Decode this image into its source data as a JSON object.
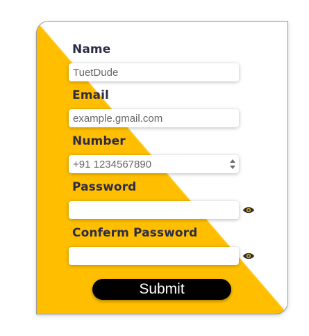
{
  "form": {
    "name": {
      "label": "Name",
      "value": "TuetDude"
    },
    "email": {
      "label": "Email",
      "value": "example.gmail.com"
    },
    "number": {
      "label": "Number",
      "value": "+91 1234567890"
    },
    "password": {
      "label": "Password",
      "value": ""
    },
    "confirm_password": {
      "label": "Conferm Password",
      "value": ""
    },
    "submit_label": "Submit"
  },
  "colors": {
    "accent": "#ffbf00",
    "label_text": "#2c2c48",
    "button": "#000000"
  },
  "icons": {
    "password_toggle": "eye-icon",
    "confirm_password_toggle": "eye-icon",
    "number_stepper": "spinner-arrows-icon"
  }
}
